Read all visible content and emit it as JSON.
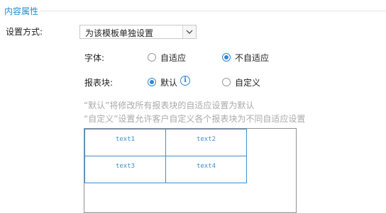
{
  "section": {
    "title": "内容属性"
  },
  "setting_mode": {
    "label": "设置方式:",
    "selected": "为该模板单独设置"
  },
  "font": {
    "label": "字体:",
    "options": [
      {
        "label": "自适应",
        "checked": false
      },
      {
        "label": "不自适应",
        "checked": true
      }
    ]
  },
  "report_block": {
    "label": "报表块:",
    "options": [
      {
        "label": "默认",
        "checked": true
      },
      {
        "label": "自定义",
        "checked": false
      }
    ],
    "info_icon": "info-icon"
  },
  "hints": [
    "“默认”将修改所有报表块的自适应设置为默认",
    "“自定义”设置允许客户自定义各个报表块为不同自适应设置"
  ],
  "preview": {
    "cells": [
      "text1",
      "text2",
      "text3",
      "text4"
    ]
  },
  "colors": {
    "accent": "#2f86d6",
    "title": "#1c8fd8",
    "hint": "#aaaaaa"
  }
}
